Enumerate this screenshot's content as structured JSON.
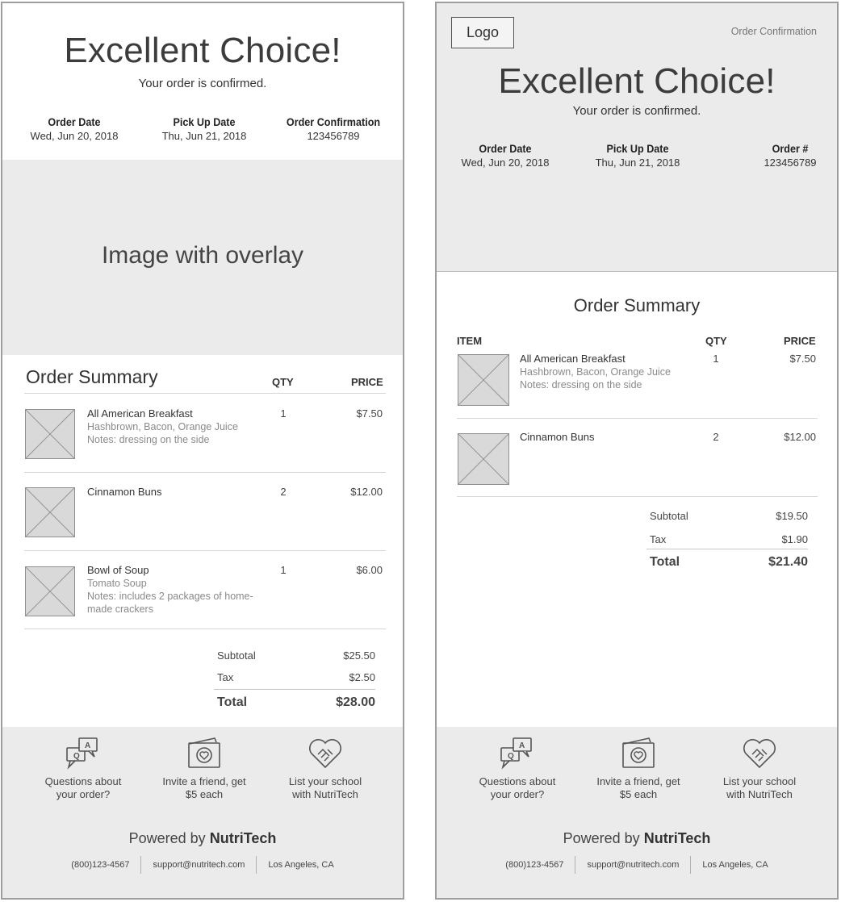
{
  "left": {
    "hero_title": "Excellent Choice!",
    "hero_sub": "Your order is confirmed.",
    "meta": [
      {
        "label": "Order Date",
        "value": "Wed, Jun 20, 2018"
      },
      {
        "label": "Pick Up Date",
        "value": "Thu, Jun 21, 2018"
      },
      {
        "label": "Order Confirmation",
        "value": "123456789"
      }
    ],
    "overlay_text": "Image with overlay",
    "summary_title": "Order Summary",
    "qty_head": "QTY",
    "price_head": "PRICE",
    "items": [
      {
        "name": "All American Breakfast",
        "desc1": "Hashbrown, Bacon, Orange Juice",
        "desc2": "Notes: dressing on the side",
        "desc3": "",
        "qty": "1",
        "price": "$7.50"
      },
      {
        "name": "Cinnamon Buns",
        "desc1": "",
        "desc2": "",
        "desc3": "",
        "qty": "2",
        "price": "$12.00"
      },
      {
        "name": "Bowl of Soup",
        "desc1": "Tomato Soup",
        "desc2": "Notes: includes 2 packages of home-",
        "desc3": "made crackers",
        "qty": "1",
        "price": "$6.00"
      }
    ],
    "subtotal_label": "Subtotal",
    "subtotal": "$25.50",
    "tax_label": "Tax",
    "tax": "$2.50",
    "total_label": "Total",
    "total": "$28.00"
  },
  "right": {
    "logo": "Logo",
    "order_confirmation_link": "Order Confirmation",
    "hero_title": "Excellent Choice!",
    "hero_sub": "Your order is confirmed.",
    "meta": [
      {
        "label": "Order Date",
        "value": "Wed, Jun 20, 2018"
      },
      {
        "label": "Pick Up Date",
        "value": "Thu, Jun 21, 2018"
      },
      {
        "label": "Order #",
        "value": "123456789"
      }
    ],
    "summary_title": "Order Summary",
    "item_head": "ITEM",
    "qty_head": "QTY",
    "price_head": "PRICE",
    "items": [
      {
        "name": "All American Breakfast",
        "desc1": "Hashbrown, Bacon, Orange Juice",
        "desc2": "Notes: dressing on the side",
        "qty": "1",
        "price": "$7.50"
      },
      {
        "name": "Cinnamon Buns",
        "desc1": "",
        "desc2": "",
        "qty": "2",
        "price": "$12.00"
      }
    ],
    "subtotal_label": "Subtotal",
    "subtotal": "$19.50",
    "tax_label": "Tax",
    "tax": "$1.90",
    "total_label": "Total",
    "total": "$21.40"
  },
  "footer": {
    "links": [
      {
        "icon": "qa-chat-icon",
        "line1": "Questions about",
        "line2": "your order?"
      },
      {
        "icon": "gift-card-heart-icon",
        "line1": "Invite a friend, get",
        "line2": "$5 each"
      },
      {
        "icon": "handshake-heart-icon",
        "line1": "List your school",
        "line2": "with NutriTech"
      }
    ],
    "powered_prefix": "Powered by",
    "brand": "NutriTech",
    "phone": "(800)123-4567",
    "email": "support@nutritech.com",
    "location": "Los Angeles, CA"
  }
}
